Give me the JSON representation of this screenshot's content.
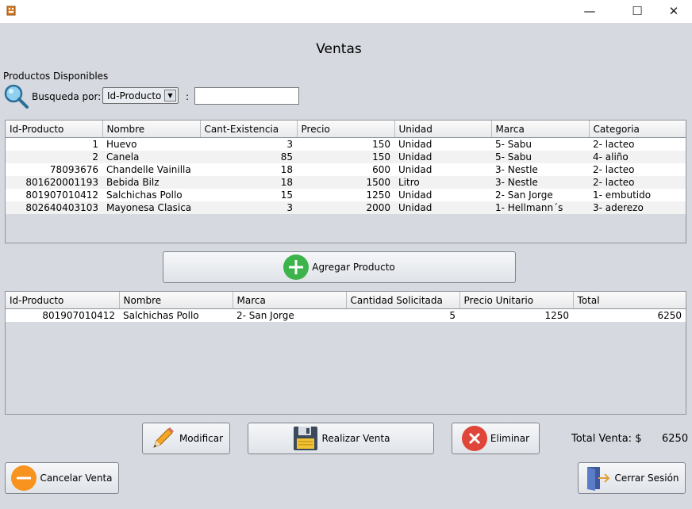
{
  "window": {
    "minimize": "—",
    "maximize": "☐",
    "close": "✕"
  },
  "title": "Ventas",
  "products_section": {
    "label": "Productos Disponibles",
    "search_by_label": "Busqueda por:",
    "search_by_selected": "Id-Producto",
    "colon": ":",
    "search_value": ""
  },
  "products_table": {
    "columns": [
      "Id-Producto",
      "Nombre",
      "Cant-Existencia",
      "Precio",
      "Unidad",
      "Marca",
      "Categoria"
    ],
    "rows": [
      [
        "1",
        "Huevo",
        "3",
        "150",
        "Unidad",
        "5- Sabu",
        "2- lacteo"
      ],
      [
        "2",
        "Canela",
        "85",
        "150",
        "Unidad",
        "5- Sabu",
        "4- aliño"
      ],
      [
        "78093676",
        "Chandelle Vainilla",
        "18",
        "600",
        "Unidad",
        "3- Nestle",
        "2- lacteo"
      ],
      [
        "801620001193",
        "Bebida Bilz",
        "18",
        "1500",
        "Litro",
        "3- Nestle",
        "2- lacteo"
      ],
      [
        "801907010412",
        "Salchichas Pollo",
        "15",
        "1250",
        "Unidad",
        "2- San Jorge",
        "1- embutido"
      ],
      [
        "802640403103",
        "Mayonesa Clasica",
        "3",
        "2000",
        "Unidad",
        "1- Hellmann´s",
        "3- aderezo"
      ]
    ]
  },
  "add_button_label": "Agregar Producto",
  "sale_table": {
    "columns": [
      "Id-Producto",
      "Nombre",
      "Marca",
      "Cantidad Solicitada",
      "Precio Unitario",
      "Total"
    ],
    "rows": [
      [
        "801907010412",
        "Salchichas Pollo",
        "2- San Jorge",
        "5",
        "1250",
        "6250"
      ]
    ]
  },
  "buttons": {
    "modify": "Modificar",
    "make_sale": "Realizar Venta",
    "delete": "Eliminar",
    "cancel_sale": "Cancelar Venta",
    "logout": "Cerrar Sesión"
  },
  "total": {
    "label": "Total Venta: $",
    "value": "6250"
  },
  "colors": {
    "add_icon": "#3cb44b",
    "delete_icon": "#e0453a",
    "cancel_icon": "#f7931e",
    "background": "#d6d9df"
  }
}
